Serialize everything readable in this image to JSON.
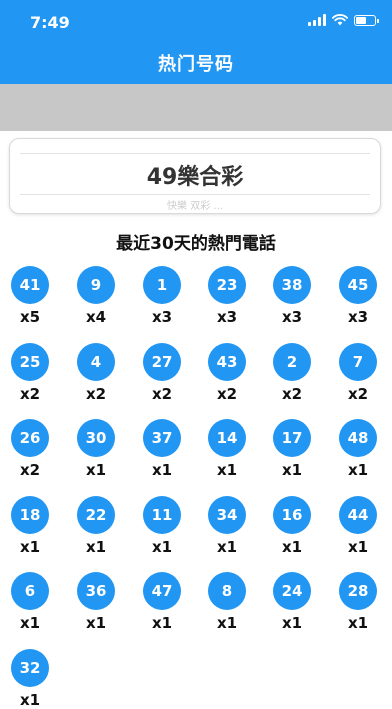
{
  "status_bar": {
    "time": "7:49"
  },
  "nav": {
    "title": "热门号码"
  },
  "picker": {
    "selected": "49樂合彩",
    "next_faded": "快樂 双彩 ..."
  },
  "heading": "最近30天的熱門電話",
  "colors": {
    "primary": "#2196f3",
    "band": "#c7c7c7"
  },
  "balls": [
    {
      "number": "41",
      "count": "x5"
    },
    {
      "number": "9",
      "count": "x4"
    },
    {
      "number": "1",
      "count": "x3"
    },
    {
      "number": "23",
      "count": "x3"
    },
    {
      "number": "38",
      "count": "x3"
    },
    {
      "number": "45",
      "count": "x3"
    },
    {
      "number": "25",
      "count": "x2"
    },
    {
      "number": "4",
      "count": "x2"
    },
    {
      "number": "27",
      "count": "x2"
    },
    {
      "number": "43",
      "count": "x2"
    },
    {
      "number": "2",
      "count": "x2"
    },
    {
      "number": "7",
      "count": "x2"
    },
    {
      "number": "26",
      "count": "x2"
    },
    {
      "number": "30",
      "count": "x1"
    },
    {
      "number": "37",
      "count": "x1"
    },
    {
      "number": "14",
      "count": "x1"
    },
    {
      "number": "17",
      "count": "x1"
    },
    {
      "number": "48",
      "count": "x1"
    },
    {
      "number": "18",
      "count": "x1"
    },
    {
      "number": "22",
      "count": "x1"
    },
    {
      "number": "11",
      "count": "x1"
    },
    {
      "number": "34",
      "count": "x1"
    },
    {
      "number": "16",
      "count": "x1"
    },
    {
      "number": "44",
      "count": "x1"
    },
    {
      "number": "6",
      "count": "x1"
    },
    {
      "number": "36",
      "count": "x1"
    },
    {
      "number": "47",
      "count": "x1"
    },
    {
      "number": "8",
      "count": "x1"
    },
    {
      "number": "24",
      "count": "x1"
    },
    {
      "number": "28",
      "count": "x1"
    },
    {
      "number": "32",
      "count": "x1"
    }
  ]
}
